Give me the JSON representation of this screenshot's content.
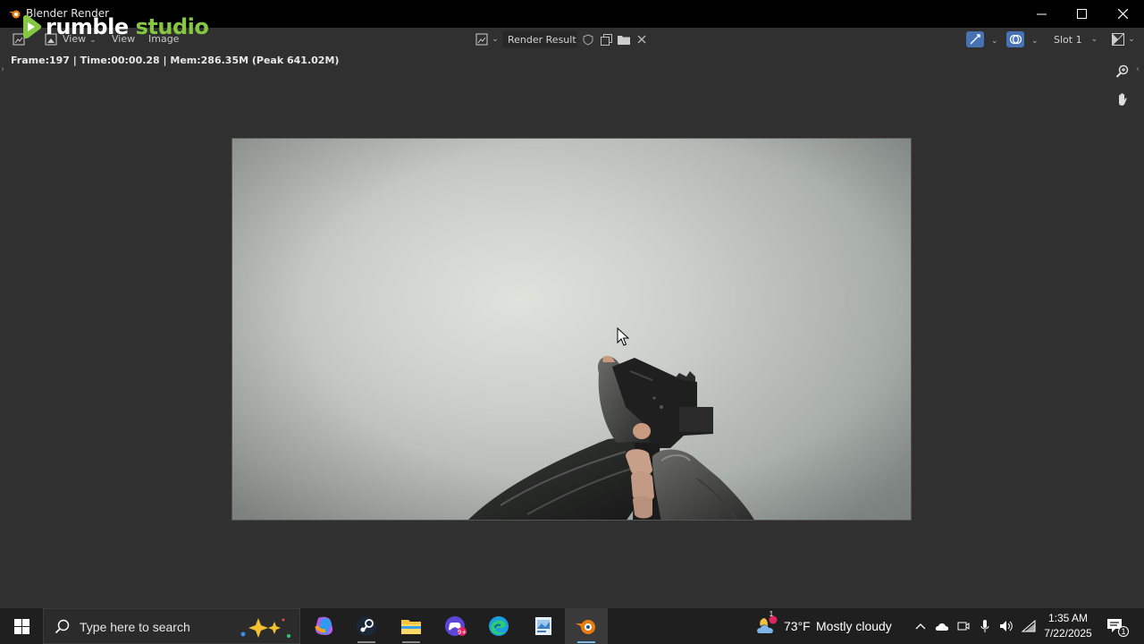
{
  "window": {
    "title": "Blender Render"
  },
  "watermark": {
    "part1": "rumble",
    "part2": "studio"
  },
  "header": {
    "menus": [
      "View",
      "View",
      "Image"
    ],
    "image_name": "Render Result",
    "slot": "Slot 1"
  },
  "status": "Frame:197 | Time:00:00.28 | Mem:286.35M (Peak 641.02M)",
  "taskbar": {
    "search_placeholder": "Type here to search",
    "weather_temp": "73°F",
    "weather_text": "Mostly cloudy",
    "weather_badge": "1",
    "time": "1:35 AM",
    "date": "7/22/2025",
    "notification_count": "1",
    "apps": [
      "copilot-icon",
      "steam-icon",
      "file-explorer-icon",
      "game-controller-icon",
      "edge-icon",
      "photo-viewer-icon",
      "blender-icon"
    ]
  },
  "colors": {
    "accent_green": "#85c742",
    "blender_orange": "#e87d0d",
    "active_blue": "#4772b3"
  }
}
